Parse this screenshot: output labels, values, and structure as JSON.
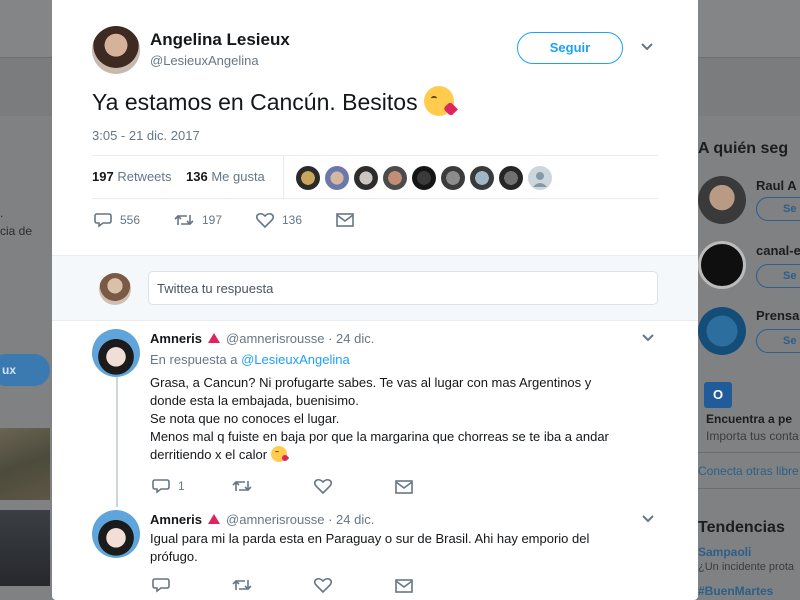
{
  "background": {
    "left_snippets": [
      ".",
      "cia de"
    ],
    "left_button": "ux",
    "sidebar_title": "A quién seg",
    "suggestions": [
      {
        "name": "Raul A",
        "button": "Se"
      },
      {
        "name": "canal-e",
        "button": "Se"
      },
      {
        "name": "Prensa",
        "button": "Se"
      }
    ],
    "outlook": {
      "icon_label": "O",
      "title": "Encuentra a pe",
      "subtitle": "Importa tus conta"
    },
    "connect_link": "Conecta otras libre",
    "trends_title": "Tendencias",
    "trends": [
      "Sampaoli",
      "¿Un incidente prota",
      "#BuenMartes"
    ]
  },
  "tweet": {
    "author_name": "Angelina Lesieux",
    "author_handle": "@LesieuxAngelina",
    "follow_label": "Seguir",
    "text": "Ya estamos en Cancún. Besitos",
    "timestamp": "3:05 - 21 dic. 2017",
    "retweets_count": "197",
    "retweets_label": "Retweets",
    "likes_count": "136",
    "likes_label": "Me gusta",
    "likers_count": 9,
    "reply_count": "556",
    "retweet_count": "197",
    "like_count": "136",
    "reply_placeholder": "Twittea tu respuesta"
  },
  "replies": [
    {
      "name": "Amneris",
      "handle": "@amnerisrousse",
      "date": "· 24 dic.",
      "in_reply_label": "En respuesta a",
      "in_reply_to": "@LesieuxAngelina",
      "lines": [
        "Grasa, a Cancun? Ni profugarte sabes. Te vas al lugar con mas Argentinos y",
        "donde esta la embajada, buenisimo.",
        "Se nota que no conoces el lugar.",
        "Menos mal q fuiste en baja por que la margarina que chorreas se te iba a andar",
        "derritiendo x el calor"
      ],
      "reply_count": "1"
    },
    {
      "name": "Amneris",
      "handle": "@amnerisrousse",
      "date": "· 24 dic.",
      "lines": [
        "Igual para mi la parda esta en Paraguay o sur de Brasil. Ahi hay emporio del",
        "prófugo."
      ]
    }
  ]
}
